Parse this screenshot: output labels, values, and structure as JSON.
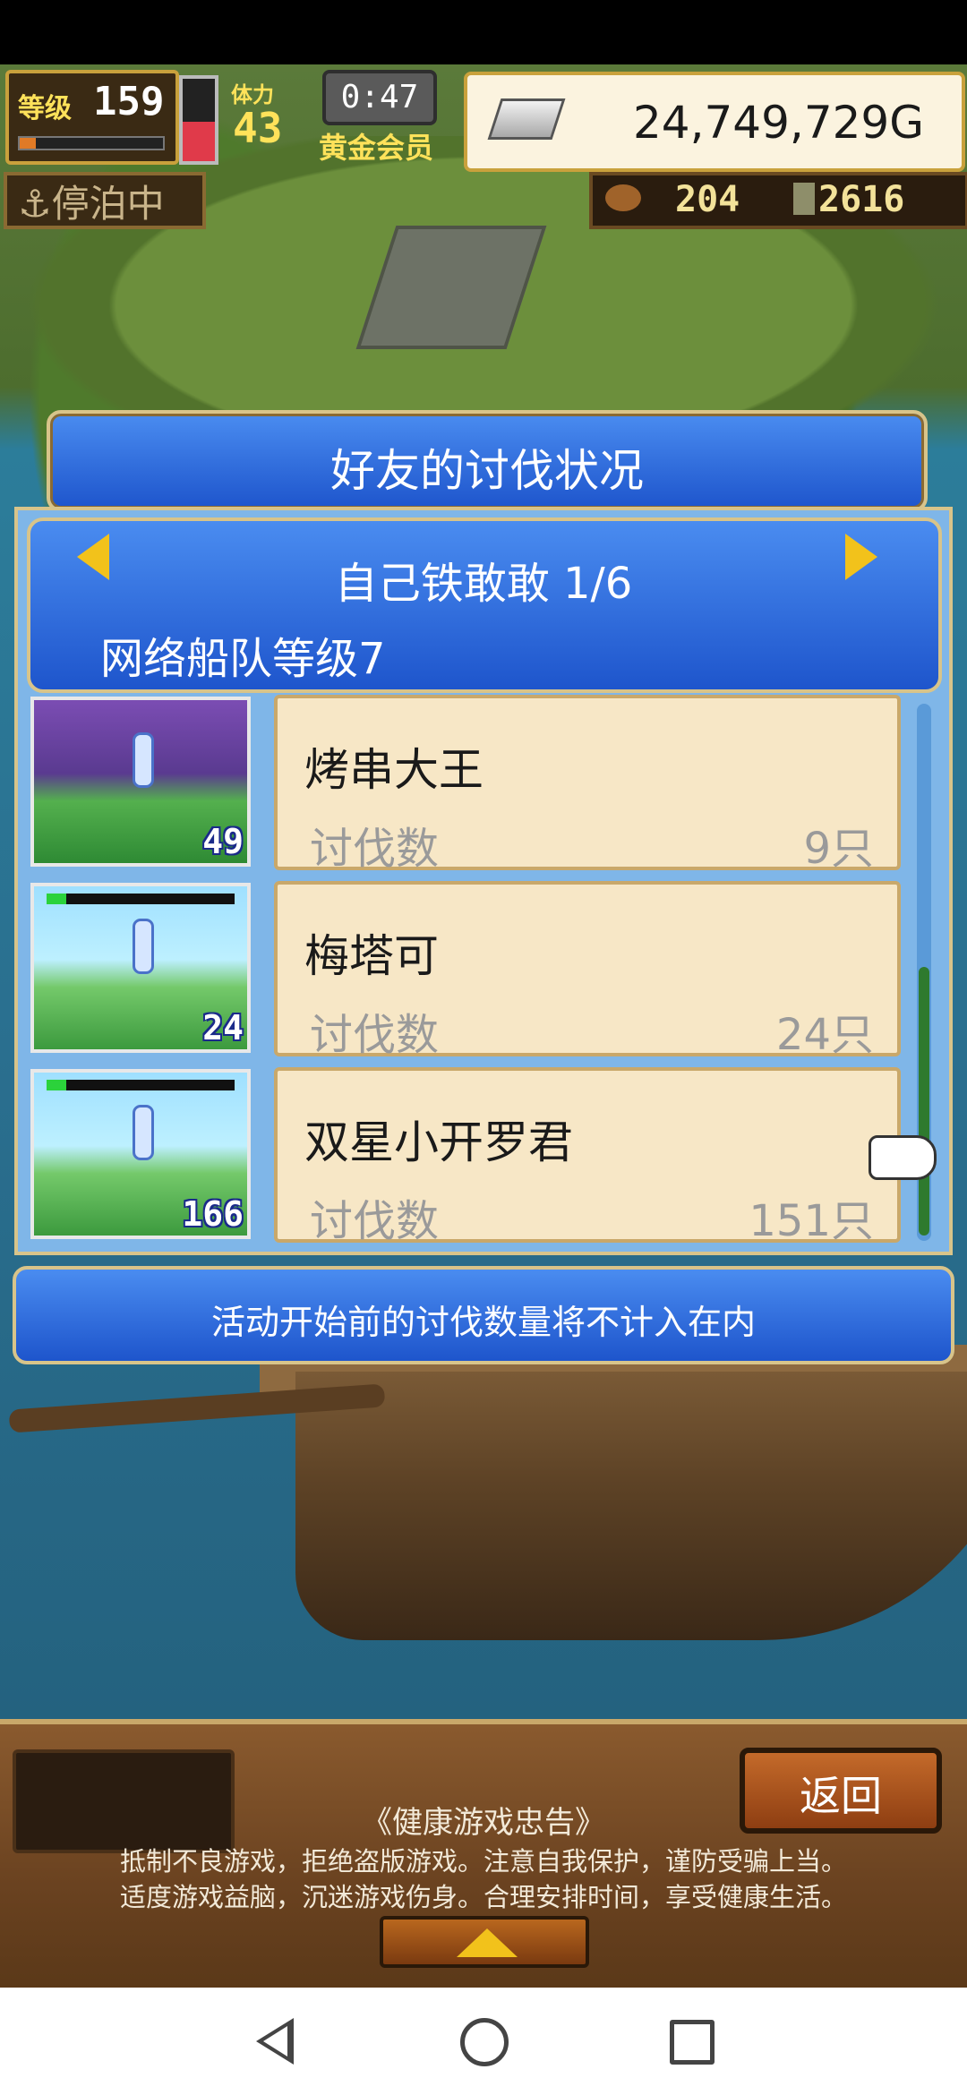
{
  "hud": {
    "level_label": "等级",
    "level": "159",
    "stamina_label": "体力",
    "stamina": "43",
    "timer": "0:47",
    "membership": "黄金会员",
    "gold": "24,749,729G",
    "status": "⚓停泊中",
    "resource1": "204",
    "resource2": "2616",
    "stamina_fill": 0.48
  },
  "dialog": {
    "title": "好友的讨伐状况",
    "friend": "自己铁敢敢 1/6",
    "fleet_level": "网络船队等级7",
    "notice": "活动开始前的讨伐数量将不计入在内"
  },
  "rows": [
    {
      "name": "烤串大王",
      "kill_label": "讨伐数",
      "kills": "9只",
      "level": "49"
    },
    {
      "name": "梅塔可",
      "kill_label": "讨伐数",
      "kills": "24只",
      "level": "24"
    },
    {
      "name": "双星小开罗君",
      "kill_label": "讨伐数",
      "kills": "151只",
      "level": "166"
    }
  ],
  "footer": {
    "back_label": "返回",
    "health_title": "《健康游戏忠告》",
    "health_line1": "抵制不良游戏，拒绝盗版游戏。注意自我保护，谨防受骗上当。",
    "health_line2": "适度游戏益脑，沉迷游戏伤身。合理安排时间，享受健康生活。"
  },
  "colors": {
    "panel_blue": "#1e55cc",
    "gold_frame": "#d8c48a",
    "card_bg": "#f7e7c6",
    "arrow_yellow": "#f2c21b"
  },
  "icons": [
    "silver-ingot-icon",
    "anchor-icon",
    "meat-icon",
    "lumber-icon",
    "arrow-left-icon",
    "arrow-right-icon",
    "pointer-hand-icon",
    "triangle-up-icon"
  ]
}
